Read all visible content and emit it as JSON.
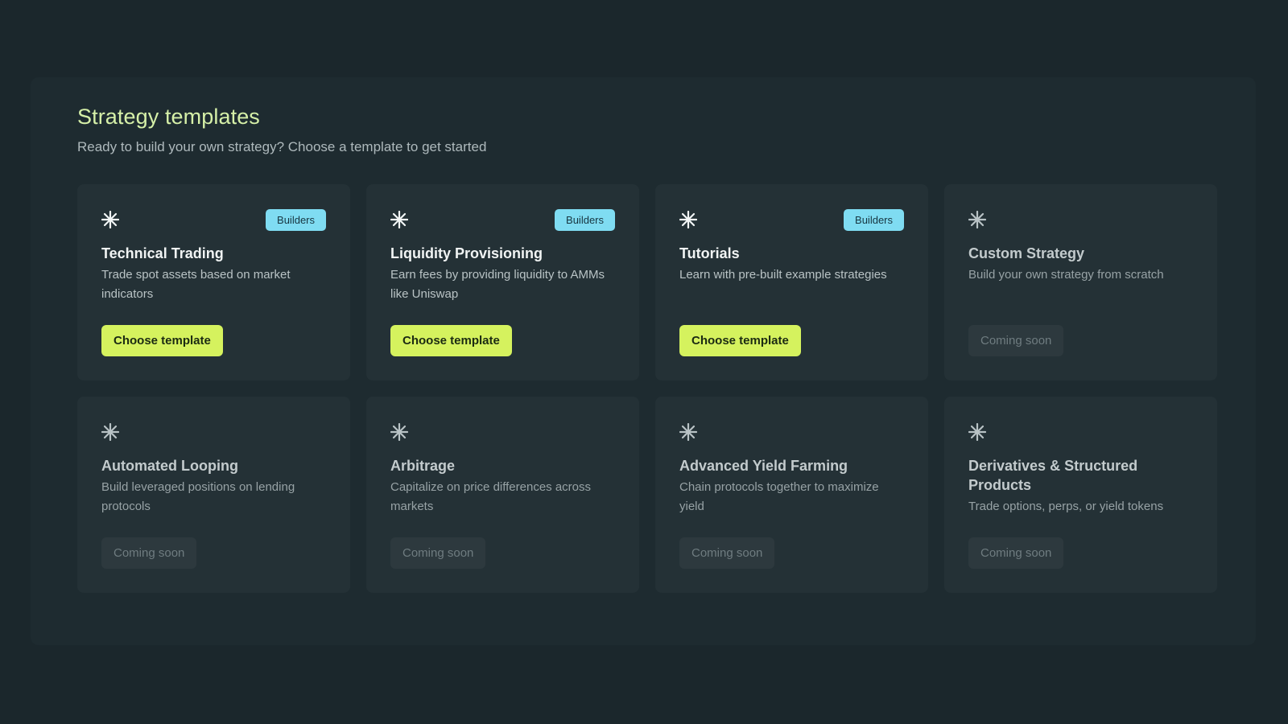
{
  "header": {
    "title": "Strategy templates",
    "subtitle": "Ready to build your own strategy? Choose a template to get started"
  },
  "colors": {
    "background": "#1b272c",
    "card": "#243136",
    "accent": "#d5f25e",
    "badge": "#7fdcf2",
    "title": "#d6f0a8"
  },
  "icon": "sparkle-asterisk-icon",
  "cards": [
    {
      "title": "Technical Trading",
      "desc": "Trade spot assets based on market indicators",
      "badge": "Builders",
      "action": "Choose template",
      "enabled": true
    },
    {
      "title": "Liquidity Provisioning",
      "desc": "Earn fees by providing liquidity to AMMs like Uniswap",
      "badge": "Builders",
      "action": "Choose template",
      "enabled": true
    },
    {
      "title": "Tutorials",
      "desc": "Learn with pre-built example strategies",
      "badge": "Builders",
      "action": "Choose template",
      "enabled": true
    },
    {
      "title": "Custom Strategy",
      "desc": "Build your own strategy from scratch",
      "badge": "",
      "action": "Coming soon",
      "enabled": false
    },
    {
      "title": "Automated Looping",
      "desc": "Build leveraged positions on lending protocols",
      "badge": "",
      "action": "Coming soon",
      "enabled": false
    },
    {
      "title": "Arbitrage",
      "desc": "Capitalize on price differences across markets",
      "badge": "",
      "action": "Coming soon",
      "enabled": false
    },
    {
      "title": "Advanced Yield Farming",
      "desc": "Chain protocols together to maximize yield",
      "badge": "",
      "action": "Coming soon",
      "enabled": false
    },
    {
      "title": "Derivatives & Structured Products",
      "desc": "Trade options, perps, or yield tokens",
      "badge": "",
      "action": "Coming soon",
      "enabled": false
    }
  ]
}
